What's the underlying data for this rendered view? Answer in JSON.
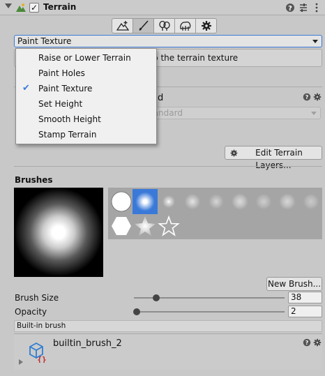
{
  "header": {
    "title": "Terrain",
    "enabled_checkbox": "✓",
    "help_icon": "help-icon",
    "settings_icon": "preset-icon",
    "menu_icon": "context-menu-icon"
  },
  "toolbar": {
    "tools": [
      {
        "name": "create-neighbor-terrains-icon"
      },
      {
        "name": "paint-terrain-icon",
        "active": true
      },
      {
        "name": "paint-trees-icon"
      },
      {
        "name": "paint-details-icon"
      },
      {
        "name": "terrain-settings-icon"
      }
    ]
  },
  "tool_select": {
    "value": "Paint Texture"
  },
  "help_text": "nto the terrain texture",
  "material": {
    "label_partial": "d",
    "dropdown_value": "tandard"
  },
  "layers": {
    "edit_button": "Edit Terrain Layers..."
  },
  "brushes": {
    "heading": "Brushes",
    "new_brush_button": "New Brush...",
    "brush_size_label": "Brush Size",
    "brush_size_value": "38",
    "brush_size_fraction": 0.15,
    "opacity_label": "Opacity",
    "opacity_value": "2",
    "opacity_fraction": 0.02,
    "info_text": "Built-in brush",
    "asset_name": "builtin_brush_2"
  },
  "dropdown_menu": {
    "items": [
      {
        "label": "Raise or Lower Terrain",
        "checked": false
      },
      {
        "label": "Paint Holes",
        "checked": false
      },
      {
        "label": "Paint Texture",
        "checked": true
      },
      {
        "label": "Set Height",
        "checked": false
      },
      {
        "label": "Smooth Height",
        "checked": false
      },
      {
        "label": "Stamp Terrain",
        "checked": false
      }
    ],
    "check_glyph": "✔"
  },
  "colors": {
    "accent": "#3a79d8",
    "panel": "#c8c8c8"
  }
}
